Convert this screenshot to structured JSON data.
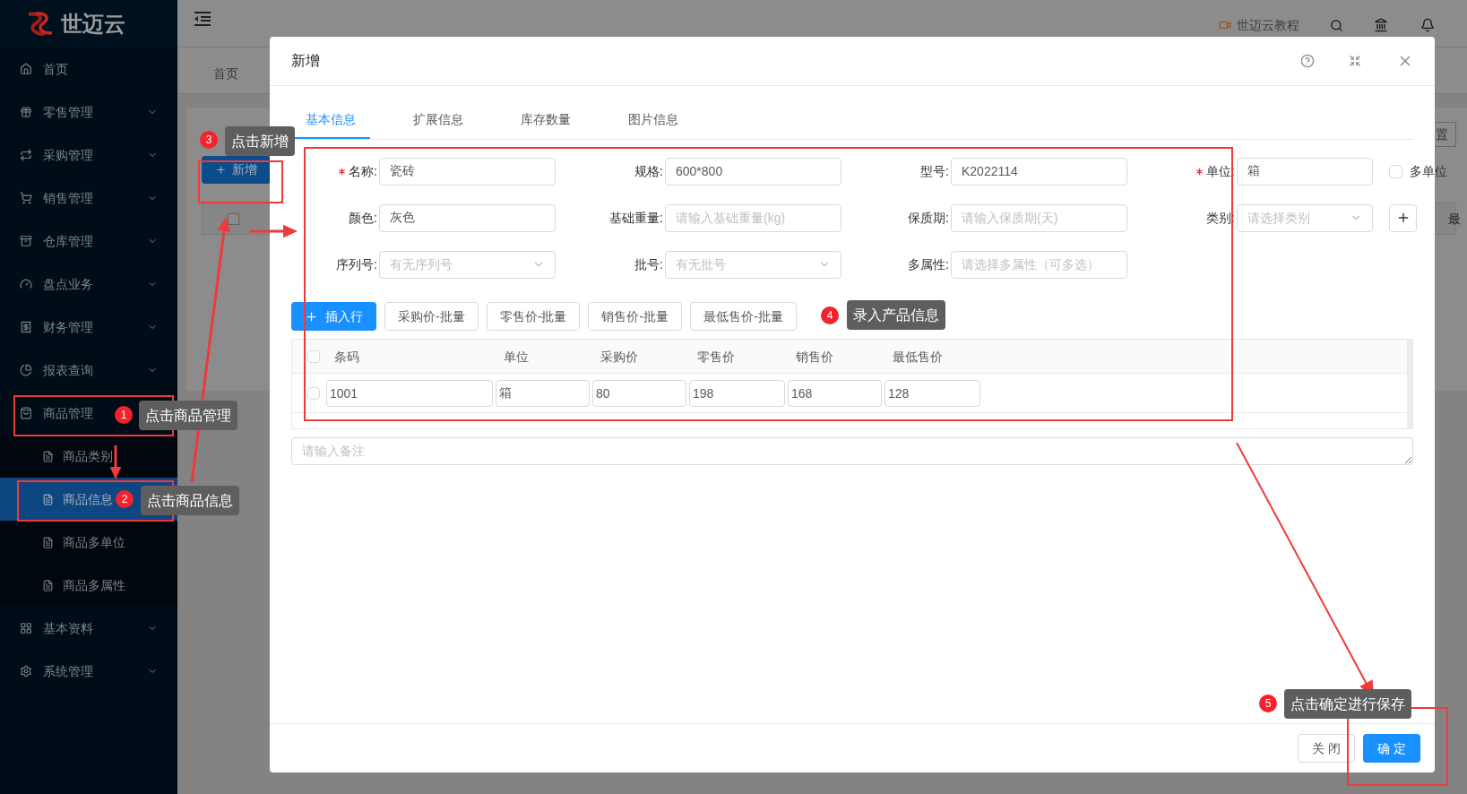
{
  "logo": {
    "name": "世迈云"
  },
  "header": {
    "tutorial": "世迈云教程"
  },
  "sidebar": {
    "items": [
      {
        "label": "首页"
      },
      {
        "label": "零售管理",
        "expanded": false
      },
      {
        "label": "采购管理",
        "expanded": false
      },
      {
        "label": "销售管理",
        "expanded": false
      },
      {
        "label": "仓库管理",
        "expanded": false
      },
      {
        "label": "盘点业务",
        "expanded": false
      },
      {
        "label": "财务管理",
        "expanded": false
      },
      {
        "label": "报表查询",
        "expanded": false
      },
      {
        "label": "商品管理",
        "expanded": true,
        "children": [
          {
            "label": "商品类别",
            "selected": false
          },
          {
            "label": "商品信息",
            "selected": true
          },
          {
            "label": "商品多单位",
            "selected": false
          },
          {
            "label": "商品多属性",
            "selected": false
          }
        ]
      },
      {
        "label": "基本资料",
        "expanded": false
      },
      {
        "label": "系统管理",
        "expanded": false
      }
    ]
  },
  "page": {
    "tab": "首页",
    "add_button": "新增",
    "table_checked": false,
    "right_button_fragment": "置",
    "column_fragment": "最"
  },
  "dialog": {
    "title": "新增",
    "tabs": [
      {
        "label": "基本信息",
        "selected": true
      },
      {
        "label": "扩展信息",
        "selected": false
      },
      {
        "label": "库存数量",
        "selected": false
      },
      {
        "label": "图片信息",
        "selected": false
      }
    ],
    "fields": [
      {
        "label": "名称:",
        "required": true,
        "kind": "input",
        "value": "瓷砖"
      },
      {
        "label": "规格:",
        "required": false,
        "kind": "input",
        "value": "600*800"
      },
      {
        "label": "型号:",
        "required": false,
        "kind": "input",
        "value": "K2022114"
      },
      {
        "label": "单位:",
        "required": true,
        "kind": "input",
        "value": "箱"
      },
      {
        "label": "颜色:",
        "required": false,
        "kind": "input",
        "value": "灰色"
      },
      {
        "label": "基础重量:",
        "required": false,
        "kind": "input",
        "placeholder": "请输入基础重量(kg)"
      },
      {
        "label": "保质期:",
        "required": false,
        "kind": "input",
        "placeholder": "请输入保质期(天)"
      },
      {
        "label": "类别:",
        "required": false,
        "kind": "select",
        "placeholder": "请选择类别"
      },
      {
        "label": "序列号:",
        "required": false,
        "kind": "select",
        "placeholder": "有无序列号"
      },
      {
        "label": "批号:",
        "required": false,
        "kind": "select",
        "placeholder": "有无批号"
      },
      {
        "label": "多属性:",
        "required": false,
        "kind": "input",
        "placeholder": "请选择多属性（可多选）"
      }
    ],
    "multi_unit": {
      "label": "多单位",
      "checked": false
    },
    "toolbar": {
      "insert": "插入行",
      "batch": [
        "采购价-批量",
        "零售价-批量",
        "销售价-批量",
        "最低售价-批量"
      ]
    },
    "table": {
      "header_checked": false,
      "columns": [
        "条码",
        "单位",
        "采购价",
        "零售价",
        "销售价",
        "最低售价"
      ],
      "rows": [
        {
          "checked": false,
          "cells": [
            "1001",
            "箱",
            "80",
            "198",
            "168",
            "128"
          ]
        }
      ]
    },
    "remark": {
      "placeholder": "请输入备注"
    },
    "buttons": [
      {
        "label": "关 闭",
        "kind": "default"
      },
      {
        "label": "确 定",
        "kind": "primary"
      }
    ]
  },
  "annotations": [
    {
      "number": "1",
      "text": "点击商品管理"
    },
    {
      "number": "2",
      "text": "点击商品信息"
    },
    {
      "number": "3",
      "text": "点击新增"
    },
    {
      "number": "4",
      "text": "录入产品信息"
    },
    {
      "number": "5",
      "text": "点击确定进行保存"
    }
  ]
}
